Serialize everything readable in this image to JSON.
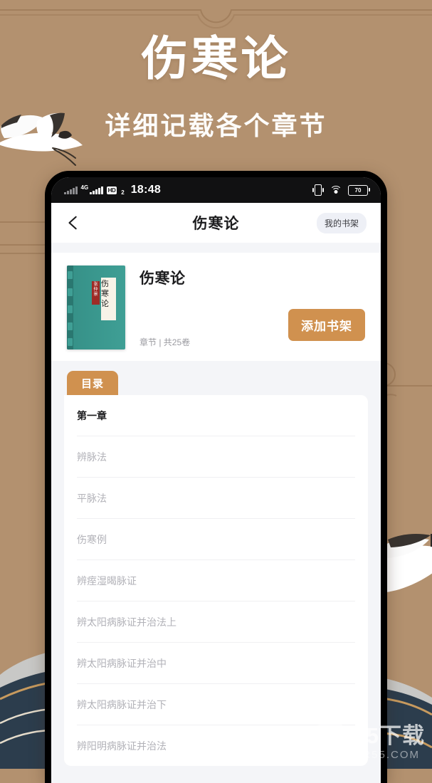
{
  "promo": {
    "title": "伤寒论",
    "subtitle": "详细记载各个章节",
    "bg_color": "#b3916f",
    "title_color": "#ffffff"
  },
  "phone": {
    "statusbar": {
      "signal_dim_icon": "signal-bars-dim-icon",
      "signal_icon": "signal-bars-icon",
      "network_label": "4G",
      "hd_badge": "HD",
      "hd_sub": "2",
      "time": "18:48",
      "vibrate_icon": "vibrate-icon",
      "wifi_icon": "wifi-icon",
      "battery_level": "70"
    },
    "navbar": {
      "back_icon": "back-chevron-icon",
      "title": "伤寒论",
      "shelf_button": "我的书架"
    },
    "book": {
      "cover": {
        "title_vertical": "伤寒论",
        "seal_text": "张仲景",
        "color": "#349189"
      },
      "title": "伤寒论",
      "meta": "章节 | 共25卷",
      "add_button": "添加书架",
      "add_button_color": "#d0914f"
    },
    "catalog": {
      "tab_label": "目录",
      "tab_color": "#d0914f",
      "rows": [
        {
          "label": "第一章",
          "is_heading": true
        },
        {
          "label": "辨脉法",
          "is_heading": false
        },
        {
          "label": "平脉法",
          "is_heading": false
        },
        {
          "label": "伤寒例",
          "is_heading": false
        },
        {
          "label": "辨痓湿暍脉证",
          "is_heading": false
        },
        {
          "label": "辨太阳病脉证并治法上",
          "is_heading": false
        },
        {
          "label": "辨太阳病脉证并治中",
          "is_heading": false
        },
        {
          "label": "辨太阳病脉证并治下",
          "is_heading": false
        },
        {
          "label": "辨阳明病脉证并治法",
          "is_heading": false
        }
      ]
    }
  },
  "watermark": {
    "mark_icon": "site-logo-55-icon",
    "primary": "55下载",
    "secondary": "RR55.COM"
  }
}
